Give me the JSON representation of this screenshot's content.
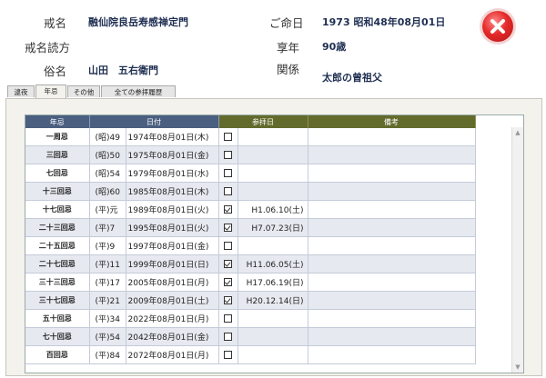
{
  "header": {
    "kaimyo_label": "戒名",
    "kaimyo_value": "融仙院良岳寿感禅定門",
    "kaimyo_reading_label": "戒名読方",
    "kaimyo_reading_value": "",
    "zokumyo_label": "俗名",
    "zokumyo_value": "山田　五右衛門",
    "meinichi_label": "ご命日",
    "meinichi_value": "1973 昭和48年08月01日",
    "kyonen_label": "享年",
    "kyonen_value": "90歳",
    "kankei_label": "関係",
    "kankei_value": "太郎の曾祖父",
    "close_icon": "close-x-icon"
  },
  "tabs": [
    {
      "label": "逮夜"
    },
    {
      "label": "年忌"
    },
    {
      "label": "その他"
    },
    {
      "label": "全ての参拝履歴"
    }
  ],
  "table": {
    "columns": [
      "年忌",
      "日付",
      "参拝日",
      "備考"
    ],
    "rows": [
      {
        "kind": "一周忌",
        "era": "(昭)49",
        "date": "1974年08月01日(木)",
        "checked": false,
        "sanpai": "",
        "biko": ""
      },
      {
        "kind": "三回忌",
        "era": "(昭)50",
        "date": "1975年08月01日(金)",
        "checked": false,
        "sanpai": "",
        "biko": ""
      },
      {
        "kind": "七回忌",
        "era": "(昭)54",
        "date": "1979年08月01日(水)",
        "checked": false,
        "sanpai": "",
        "biko": ""
      },
      {
        "kind": "十三回忌",
        "era": "(昭)60",
        "date": "1985年08月01日(木)",
        "checked": false,
        "sanpai": "",
        "biko": ""
      },
      {
        "kind": "十七回忌",
        "era": "(平)元",
        "date": "1989年08月01日(火)",
        "checked": true,
        "sanpai": "H1.06.10(土)",
        "biko": ""
      },
      {
        "kind": "二十三回忌",
        "era": "(平)7",
        "date": "1995年08月01日(火)",
        "checked": true,
        "sanpai": "H7.07.23(日)",
        "biko": ""
      },
      {
        "kind": "二十五回忌",
        "era": "(平)9",
        "date": "1997年08月01日(金)",
        "checked": false,
        "sanpai": "",
        "biko": ""
      },
      {
        "kind": "二十七回忌",
        "era": "(平)11",
        "date": "1999年08月01日(日)",
        "checked": true,
        "sanpai": "H11.06.05(土)",
        "biko": ""
      },
      {
        "kind": "三十三回忌",
        "era": "(平)17",
        "date": "2005年08月01日(月)",
        "checked": true,
        "sanpai": "H17.06.19(日)",
        "biko": ""
      },
      {
        "kind": "三十七回忌",
        "era": "(平)21",
        "date": "2009年08月01日(土)",
        "checked": true,
        "sanpai": "H20.12.14(日)",
        "biko": ""
      },
      {
        "kind": "五十回忌",
        "era": "(平)34",
        "date": "2022年08月01日(月)",
        "checked": false,
        "sanpai": "",
        "biko": ""
      },
      {
        "kind": "七十回忌",
        "era": "(平)54",
        "date": "2042年08月01日(金)",
        "checked": false,
        "sanpai": "",
        "biko": ""
      },
      {
        "kind": "百回忌",
        "era": "(平)84",
        "date": "2072年08月01日(月)",
        "checked": false,
        "sanpai": "",
        "biko": ""
      }
    ]
  }
}
